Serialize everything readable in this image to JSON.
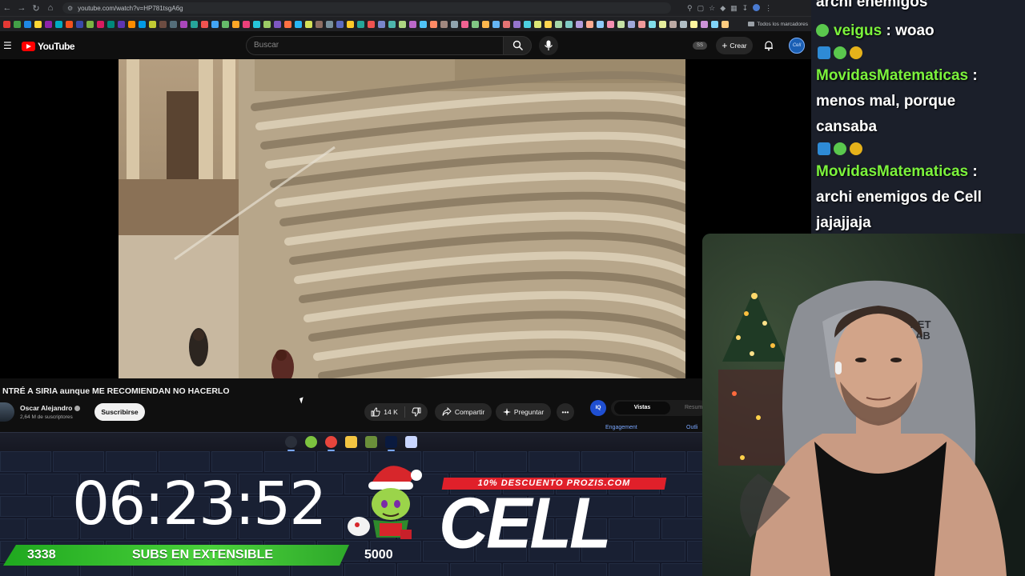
{
  "browser": {
    "url": "youtube.com/watch?v=HP781tsgA6g",
    "bookmarks_folder": "Todos los marcadores",
    "bookmark_colors": [
      "#e53935",
      "#43a047",
      "#1e88e5",
      "#fdd835",
      "#8e24aa",
      "#00acc1",
      "#f4511e",
      "#3949ab",
      "#7cb342",
      "#d81b60",
      "#00897b",
      "#5e35b1",
      "#fb8c00",
      "#039be5",
      "#c0ca33",
      "#6d4c41",
      "#546e7a",
      "#ab47bc",
      "#26a69a",
      "#ef5350",
      "#42a5f5",
      "#66bb6a",
      "#ffa726",
      "#ec407a",
      "#26c6da",
      "#9ccc65",
      "#7e57c2",
      "#ff7043",
      "#29b6f6",
      "#d4e157",
      "#8d6e63",
      "#78909c",
      "#5c6bc0",
      "#ffca28",
      "#26a69a",
      "#ef5350",
      "#7986cb",
      "#4db6ac",
      "#aed581",
      "#ba68c8",
      "#4fc3f7",
      "#ff8a65",
      "#a1887f",
      "#90a4ae",
      "#f06292",
      "#81c784",
      "#ffb74d",
      "#64b5f6",
      "#e57373",
      "#9575cd",
      "#4dd0e1",
      "#dce775",
      "#ffd54f",
      "#a5d6a7",
      "#80cbc4",
      "#b39ddb",
      "#ffab91",
      "#90caf9",
      "#f48fb1",
      "#c5e1a5",
      "#9fa8da",
      "#ef9a9a",
      "#80deea",
      "#e6ee9c",
      "#bcaaa4",
      "#b0bec5",
      "#fff59d",
      "#ce93d8",
      "#81d4fa",
      "#ffcc80"
    ]
  },
  "youtube": {
    "logo_text": "YouTube",
    "search_placeholder": "Buscar",
    "ss_badge": "SS",
    "create_label": "Crear",
    "avatar_text": "Cell",
    "video_title": "NTRÉ A SIRIA aunque ME RECOMIENDAN NO HACERLO",
    "channel_name": "Oscar Alejandro",
    "channel_subs": "2,64 M de suscriptores",
    "subscribe_label": "Suscribirse",
    "like_count": "14 K",
    "share_label": "Compartir",
    "ask_label": "Preguntar",
    "more_label": "•••"
  },
  "extension": {
    "logo_text": "IQ",
    "tab_views": "Vistas",
    "tab_summary": "Resum",
    "engagement_label": "Engagement",
    "outlier_label": "Outli"
  },
  "taskbar": {
    "icons": [
      {
        "name": "steam-icon",
        "color": "#2a2f3a"
      },
      {
        "name": "xbox-icon",
        "color": "#7cc33f"
      },
      {
        "name": "chrome-icon",
        "color": "#e8453c"
      },
      {
        "name": "folder-icon",
        "color": "#f4c542"
      },
      {
        "name": "app-icon",
        "color": "#6b8f3a"
      },
      {
        "name": "photoshop-icon",
        "color": "#0a1a3f"
      },
      {
        "name": "paint-icon",
        "color": "#c9d6ff"
      }
    ]
  },
  "overlay": {
    "timer": "06:23:52",
    "subs_count": "3338",
    "subs_label": "SUBS EN EXTENSIBLE",
    "goal": "5000",
    "promo": "10% DESCUENTO PROZIS.COM",
    "brand": "CELL"
  },
  "chat": {
    "messages": [
      {
        "text": "archi enemigos"
      },
      {
        "user": "veigus",
        "text": " : woao"
      },
      {
        "user": "MovidasMatematicas",
        "text": " :"
      },
      {
        "text": "menos mal, porque"
      },
      {
        "text": "cansaba"
      },
      {
        "user": "MovidasMatematicas",
        "text": " :"
      },
      {
        "text": "archi enemigos de Cell"
      },
      {
        "text": "jajajjaja"
      }
    ],
    "colors": {
      "username": "#7cf33c",
      "text": "#ffffff"
    }
  },
  "webcam": {
    "chair_brand_line1": "CRET",
    "chair_brand_line2": "LAB"
  }
}
